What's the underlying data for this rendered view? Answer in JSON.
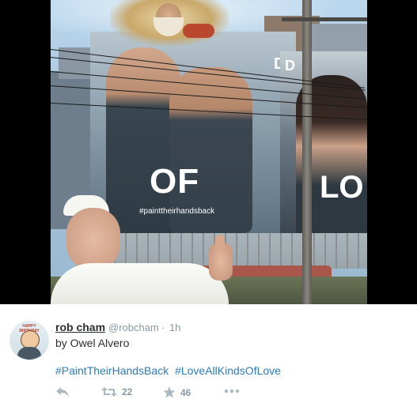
{
  "image": {
    "billboard_left_text": "OF",
    "billboard_left_hashtag": "#painttheirhandsback",
    "billboard_left_brand": "D",
    "billboard_right_text": "LO",
    "billboard_right_brand": "D"
  },
  "tweet": {
    "display_name": "rob cham",
    "handle": "@robcham",
    "separator": "·",
    "time": "1h",
    "text": "by Owel Alvero",
    "hashtags": [
      "#PaintTheirHandsBack",
      "#LoveAllKindsOfLove"
    ],
    "retweet_count": "22",
    "favorite_count": "46",
    "avatar_caption": "HAPPY BIRTHDAY"
  },
  "actions": {
    "reply_icon": "reply-icon",
    "retweet_icon": "retweet-icon",
    "favorite_icon": "star-icon",
    "more_icon": "more-icon"
  },
  "colors": {
    "link": "#2b7bb9",
    "muted": "#8899a6",
    "text": "#292f33"
  }
}
